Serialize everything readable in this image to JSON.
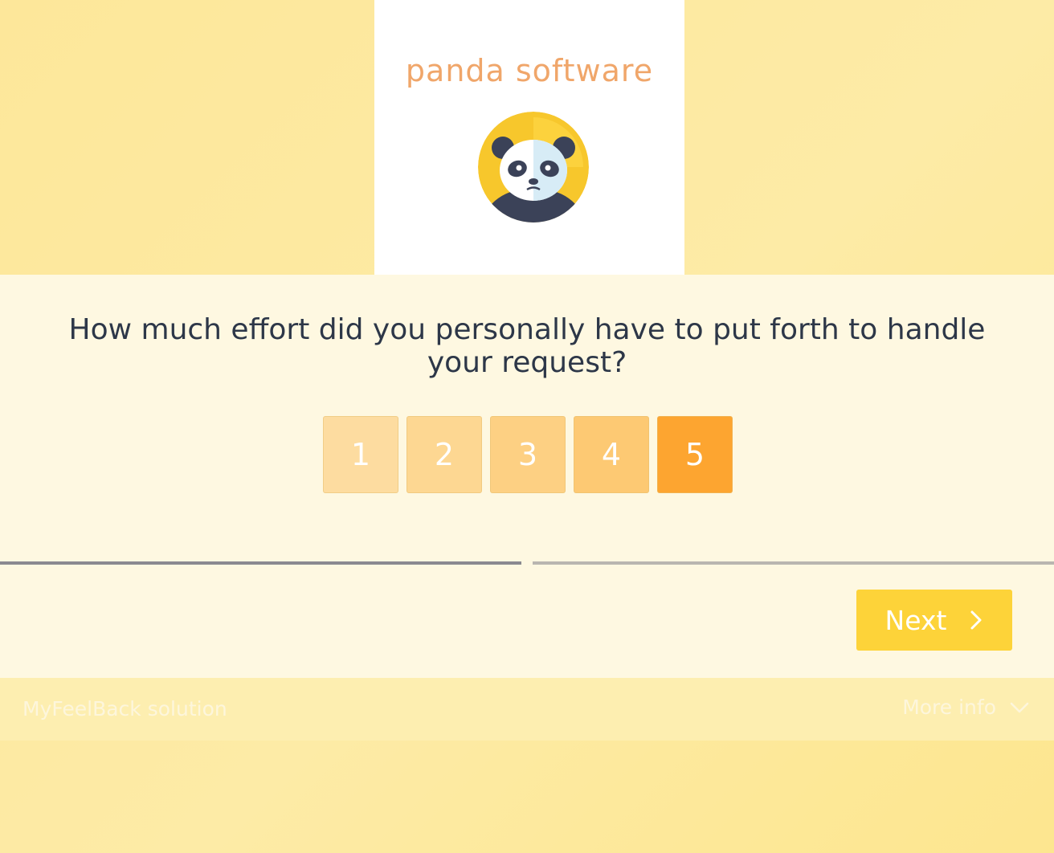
{
  "brand": {
    "name": "panda software",
    "logo_icon": "panda-icon"
  },
  "question": {
    "text": "How much effort did you personally have to put forth to handle your request?"
  },
  "scale": {
    "options": [
      {
        "label": "1",
        "color": "#fddca0"
      },
      {
        "label": "2",
        "color": "#fdd792"
      },
      {
        "label": "3",
        "color": "#fdd083"
      },
      {
        "label": "4",
        "color": "#fdc973"
      },
      {
        "label": "5",
        "color": "#fda530"
      }
    ]
  },
  "progress": {
    "fraction": 0.5
  },
  "navigation": {
    "next_label": "Next",
    "next_icon": "chevron-right-icon"
  },
  "footer": {
    "left_text": "MyFeelBack solution",
    "right_text": "More info",
    "right_icon": "chevron-down-icon"
  },
  "colors": {
    "accent": "#fdd339",
    "selected": "#fda530",
    "background": "#fde79a"
  }
}
